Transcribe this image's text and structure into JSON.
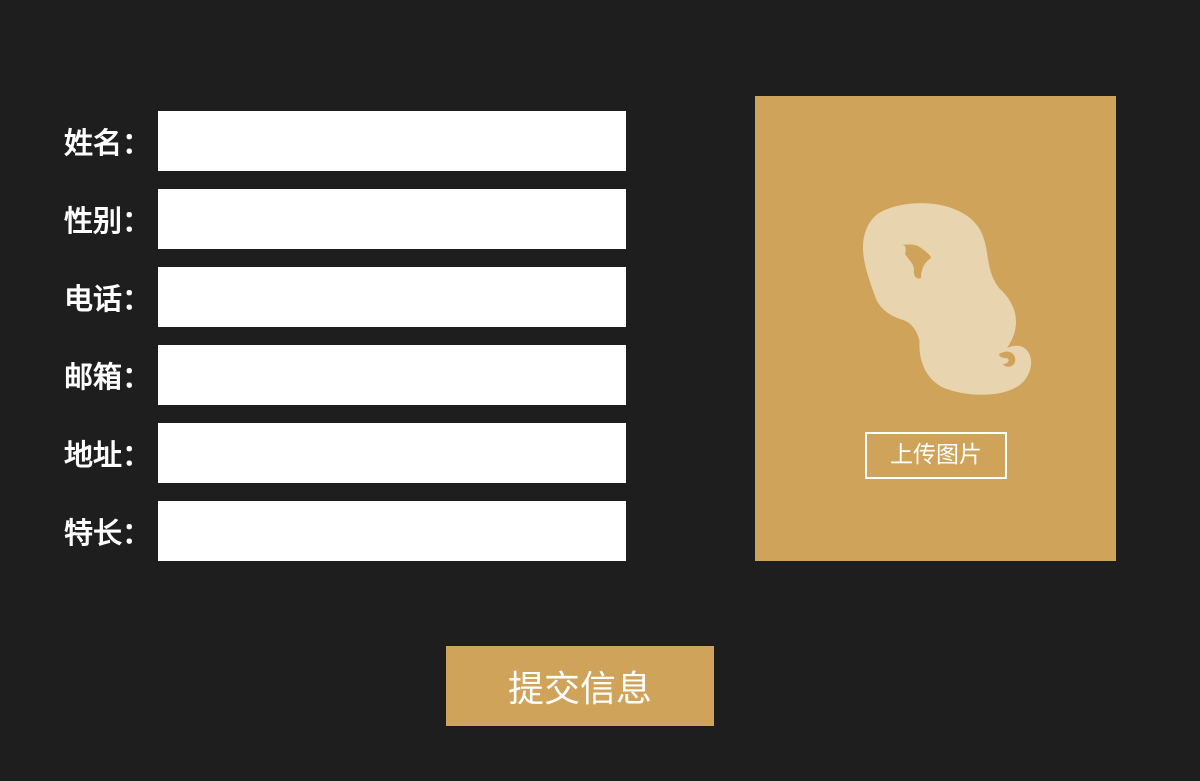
{
  "form": {
    "fields": [
      {
        "label": "姓名：",
        "value": "",
        "placeholder": ""
      },
      {
        "label": "性别：",
        "value": "",
        "placeholder": ""
      },
      {
        "label": "电话：",
        "value": "",
        "placeholder": ""
      },
      {
        "label": "邮箱：",
        "value": "",
        "placeholder": ""
      },
      {
        "label": "地址：",
        "value": "",
        "placeholder": ""
      },
      {
        "label": "特长：",
        "value": "",
        "placeholder": ""
      }
    ]
  },
  "photo_panel": {
    "icon": "woman-profile-icon",
    "upload_label": "上传图片"
  },
  "submit": {
    "label": "提交信息"
  },
  "colors": {
    "background": "#1e1e1e",
    "accent": "#cfa45a",
    "icon_fill": "#e8d4ae",
    "field_bg": "#ffffff",
    "text": "#ffffff"
  }
}
